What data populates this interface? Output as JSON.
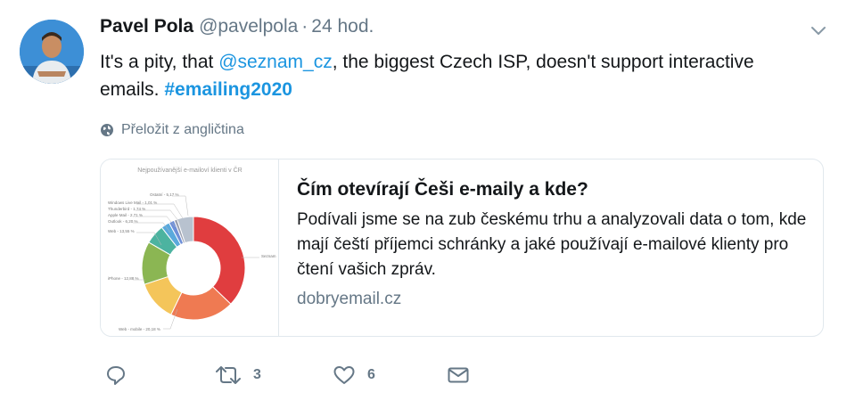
{
  "tweet": {
    "author_name": "Pavel Pola",
    "handle": "@pavelpola",
    "separator": "·",
    "time": "24 hod.",
    "text_before": "It's a pity, that ",
    "mention": "@seznam_cz",
    "text_after": ", the biggest Czech ISP, doesn't support interactive emails. ",
    "hashtag": "#emailing2020",
    "translate_label": "Přeložit z angličtina"
  },
  "card": {
    "title": "Čím otevírají Češi e-maily a kde?",
    "description": "Podívali jsme se na zub českému trhu a analyzovali data o tom, kde mají čeští příjemci schránky a jaké používají e-mailové klienty pro čtení vašich zpráv.",
    "domain": "dobryemail.cz",
    "thumbnail": {
      "title": "Nejpoužívanější e-mailoví klienti v ČR",
      "labels": [
        "Ostatní - 5,17 %",
        "Windows Live Mail - 1,01 %",
        "Thunderbird - 1,74 %",
        "Apple Mail - 2,71 %",
        "Outlook - 6,20 %",
        "Web - 13,55 %",
        "Seznam",
        "iPhone - 12,88 %",
        "Web - mobile - 20,18 %"
      ]
    }
  },
  "chart_data": {
    "type": "pie",
    "title": "Nejpoužívanější e-mailoví klienti v ČR",
    "categories": [
      "Seznam",
      "Web - mobile",
      "iPhone",
      "Web",
      "Outlook",
      "Apple Mail",
      "Thunderbird",
      "Windows Live Mail",
      "Ostatní"
    ],
    "values": [
      37.56,
      20.18,
      12.88,
      13.55,
      6.2,
      2.71,
      1.74,
      1.01,
      5.17
    ],
    "colors": [
      "#e03d3f",
      "#ef7a52",
      "#f4c55a",
      "#8bb653",
      "#4cb3a0",
      "#5aa9dc",
      "#6e8fd8",
      "#9aa0b0",
      "#b8c2cf"
    ],
    "donut": true
  },
  "actions": {
    "reply_icon": "reply-icon",
    "retweet_icon": "retweet-icon",
    "retweet_count": "3",
    "like_icon": "heart-icon",
    "like_count": "6",
    "dm_icon": "envelope-icon"
  }
}
